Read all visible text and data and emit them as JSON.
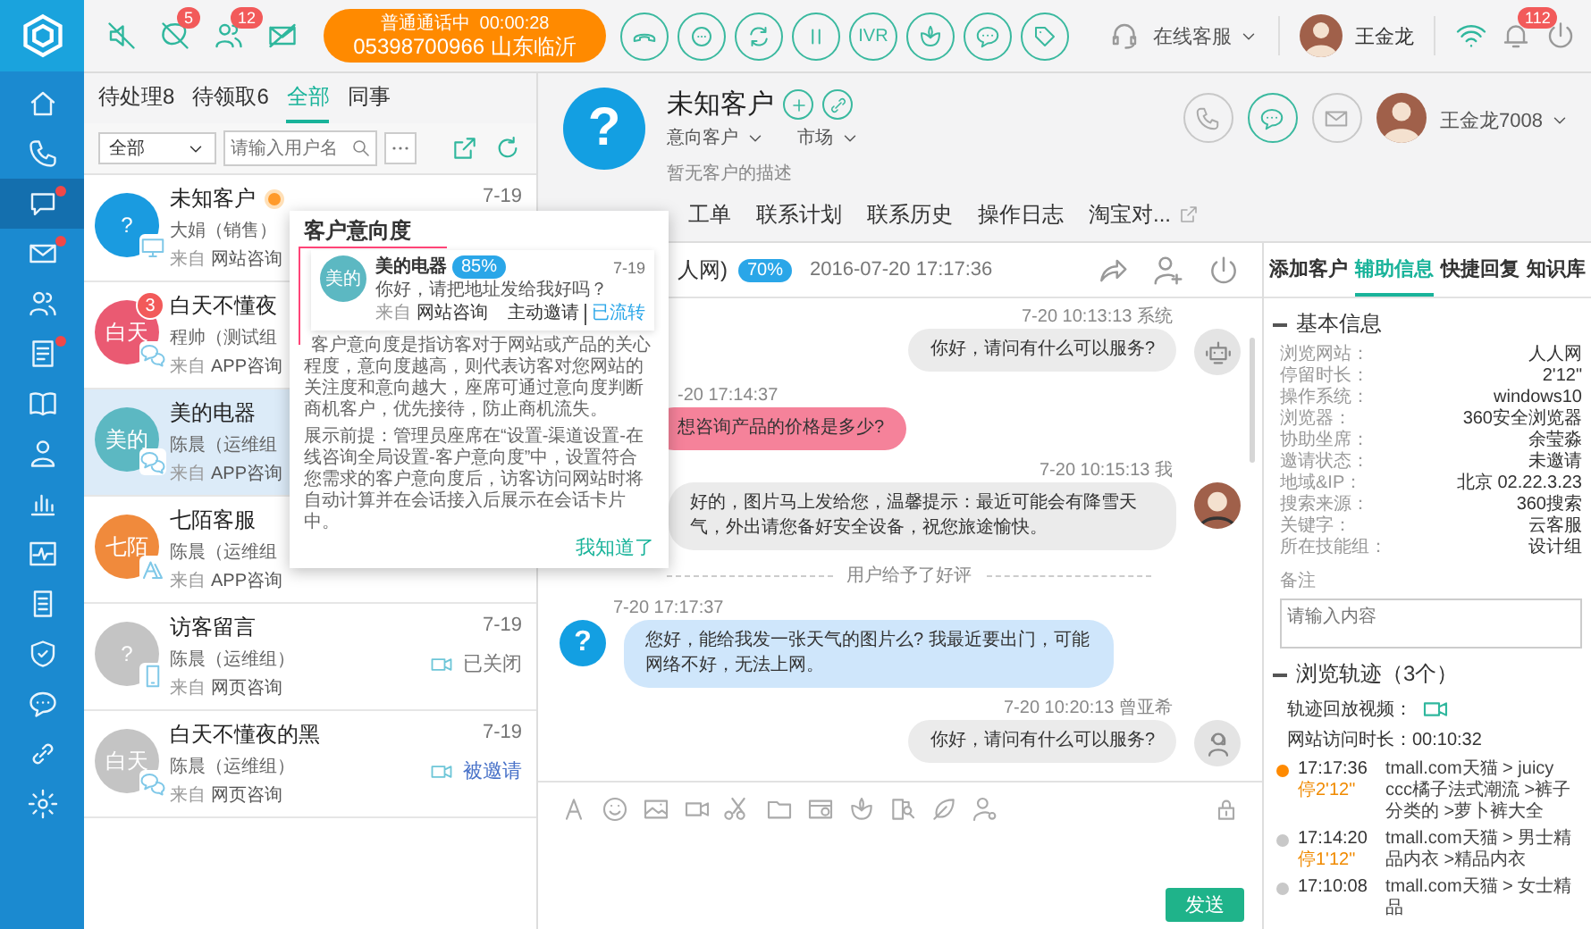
{
  "sidebar": {
    "items": [
      {
        "kind": "home",
        "selected": false,
        "alert": false
      },
      {
        "kind": "phone",
        "selected": false,
        "alert": false
      },
      {
        "kind": "chat",
        "selected": true,
        "alert": true
      },
      {
        "kind": "mail",
        "selected": false,
        "alert": true
      },
      {
        "kind": "people",
        "selected": false,
        "alert": false
      },
      {
        "kind": "list",
        "selected": false,
        "alert": true
      },
      {
        "kind": "book",
        "selected": false,
        "alert": false
      },
      {
        "kind": "person",
        "selected": false,
        "alert": false
      },
      {
        "kind": "chart",
        "selected": false,
        "alert": false
      },
      {
        "kind": "pulse",
        "selected": false,
        "alert": false
      },
      {
        "kind": "doc",
        "selected": false,
        "alert": false
      },
      {
        "kind": "shield",
        "selected": false,
        "alert": false
      },
      {
        "kind": "bubble",
        "selected": false,
        "alert": false
      },
      {
        "kind": "link",
        "selected": false,
        "alert": false
      },
      {
        "kind": "gear",
        "selected": false,
        "alert": false
      }
    ]
  },
  "top_bar": {
    "indicators": [
      {
        "kind": "mute"
      },
      {
        "kind": "phone-off",
        "badge": "5"
      },
      {
        "kind": "people",
        "badge": "12"
      },
      {
        "kind": "mail-off"
      }
    ],
    "call": {
      "status": "普通通话中",
      "timer": "00:00:28",
      "number": "05398700966 山东临沂"
    },
    "call_buttons": [
      {
        "kind": "hangup"
      },
      {
        "kind": "dial"
      },
      {
        "kind": "swap"
      },
      {
        "kind": "pause"
      },
      {
        "kind": "text",
        "label": "IVR"
      },
      {
        "kind": "flower"
      },
      {
        "kind": "bubble"
      },
      {
        "kind": "tag"
      }
    ],
    "agent_status": "在线客服",
    "agent_name": "王金龙",
    "notifications": "112"
  },
  "list_tabs": [
    {
      "label": "待处理8",
      "selected": false
    },
    {
      "label": "待领取6",
      "selected": false
    },
    {
      "label": "全部",
      "selected": true
    },
    {
      "label": "同事",
      "selected": false
    }
  ],
  "filter": {
    "value": "全部",
    "search_placeholder": "请输入用户名"
  },
  "conversations": [
    {
      "avatar": "?",
      "color": "#1a9be0",
      "kind": "web",
      "name": "未知客户",
      "flagged": true,
      "agent": "大娟（销售）",
      "from_label": "来自",
      "source": "网站咨询",
      "time": "7-19",
      "selected": false
    },
    {
      "avatar": "白天",
      "color": "#ea5a72",
      "kind": "wechat",
      "unread": "3",
      "name": "白天不懂夜",
      "flagged": false,
      "agent": "程帅（测试组",
      "from_label": "来自",
      "source": "APP咨询",
      "selected": false
    },
    {
      "avatar": "美的",
      "color": "#5cb8c2",
      "kind": "wechat",
      "name": "美的电器",
      "flagged": false,
      "agent": "陈晨（运维组",
      "from_label": "来自",
      "source": "APP咨询",
      "selected": true
    },
    {
      "avatar": "七陌",
      "color": "#f08a3c",
      "kind": "app",
      "name": "七陌客服",
      "flagged": false,
      "agent": "陈晨（运维组",
      "from_label": "来自",
      "source": "APP咨询",
      "selected": false
    },
    {
      "avatar": "?",
      "color": "#c4c4c4",
      "kind": "mobile",
      "name": "访客留言",
      "flagged": false,
      "agent": "陈晨（运维组）",
      "from_label": "来自",
      "source": "网页咨询",
      "time": "7-19",
      "status": {
        "kind": "closed",
        "label": "已关闭"
      },
      "selected": false
    },
    {
      "avatar": "白天",
      "color": "#c4c4c4",
      "kind": "wechat",
      "name": "白天不懂夜的黑",
      "flagged": false,
      "agent": "陈晨（运维组）",
      "from_label": "来自",
      "source": "网页咨询",
      "time": "7-19",
      "status": {
        "kind": "invited",
        "label": "被邀请"
      },
      "selected": false
    }
  ],
  "intent_popup": {
    "title": "客户意向度",
    "sample": {
      "avatar": "美的",
      "name": "美的电器",
      "score": "85%",
      "time": "7-19",
      "message": "你好，请把地址发给我好吗？",
      "action": "主动邀请",
      "state": "已流转",
      "from_label": "来自",
      "source": "网站咨询"
    },
    "paragraphs": [
      "客户意向度是指访客对于网站或产品的关心程度，意向度越高，则代表访客对您网站的关注度和意向越大，座席可通过意向度判断商机客户，优先接待，防止商机流失。",
      "展示前提：管理员座席在“设置-渠道设置-在线咨询全局设置-客户意向度”中，设置符合您需求的客户意向度后，访客访问网站时将自动计算并在会话接入后展示在会话卡片中。"
    ],
    "button": "我知道了"
  },
  "customer": {
    "avatar": "?",
    "name": "未知客户",
    "fields": [
      "意向客户",
      "市场"
    ],
    "description": "暂无客户的描述",
    "agent": "王金龙7008",
    "tabs": [
      "工单",
      "联系计划",
      "联系历史",
      "操作日志",
      "淘宝对..."
    ]
  },
  "chat": {
    "source": "人网)",
    "score": "70%",
    "started": "2016-07-20 17:17:36",
    "messages": [
      {
        "kind": "agent",
        "avatar": {
          "kind": "robot"
        },
        "meta": "7-20  10:13:13  系统",
        "text": "你好，请问有什么可以服务?",
        "color": "#ebebeb"
      },
      {
        "kind": "customer",
        "meta": "-20  17:14:37",
        "text": "想咨询产品的价格是多少?",
        "color": "#f5829a"
      },
      {
        "kind": "agent",
        "avatar": {
          "kind": "photo"
        },
        "meta": "7-20  10:15:13  我",
        "text": "好的，图片马上发给您，温馨提示：最近可能会有降雪天气，外出请您备好安全设备，祝您旅途愉快。",
        "color": "#ebebeb"
      },
      {
        "kind": "notice",
        "text": "用户给予了好评"
      },
      {
        "kind": "customer",
        "avatar": {
          "kind": "question",
          "text": "?"
        },
        "meta": "7-20  17:17:37",
        "text": "您好，能给我发一张天气的图片么? 我最近要出门，可能网络不好，无法上网。",
        "color": "#cfe6fb"
      },
      {
        "kind": "agent",
        "avatar": {
          "kind": "headset"
        },
        "meta": "7-20  10:20:13  曾亚希",
        "text": "你好，请问有什么可以服务?",
        "color": "#ebebeb"
      }
    ],
    "send": "发送"
  },
  "info_tabs": [
    {
      "label": "添加客户",
      "selected": false
    },
    {
      "label": "辅助信息",
      "selected": true
    },
    {
      "label": "快捷回复",
      "selected": false
    },
    {
      "label": "知识库",
      "selected": false
    }
  ],
  "basic_info": {
    "title": "基本信息",
    "rows": [
      {
        "label": "浏览网站：",
        "value": "人人网"
      },
      {
        "label": "停留时长：",
        "value": "2'12\""
      },
      {
        "label": "操作系统：",
        "value": "windows10"
      },
      {
        "label": "浏览器：",
        "value": "360安全浏览器"
      },
      {
        "label": "协助坐席：",
        "value": "余莹淼"
      },
      {
        "label": "邀请状态：",
        "value": "未邀请"
      },
      {
        "label": "地域&IP：",
        "value": "北京  02.22.3.23"
      },
      {
        "label": "搜索来源：",
        "value": "360搜索"
      },
      {
        "label": "关键字：",
        "value": "云客服"
      },
      {
        "label": "所在技能组：",
        "value": "设计组"
      }
    ],
    "note_label": "备注",
    "note_placeholder": "请输入内容"
  },
  "trail": {
    "title": "浏览轨迹（3个）",
    "video_label": "轨迹回放视频：",
    "duration": "网站访问时长：00:10:32",
    "entries": [
      {
        "time": "17:17:36",
        "stay": "停2'12\"",
        "path": "tmall.com天猫 > juicy ccc橘子法式潮流 >裤子分类的 >萝卜裤大全",
        "current": true
      },
      {
        "time": "17:14:20",
        "stay": "停1'12\"",
        "path": "tmall.com天猫 > 男士精品内衣 >精品内衣",
        "current": false
      },
      {
        "time": "17:10:08",
        "path": "tmall.com天猫 > 女士精品",
        "current": false
      }
    ]
  }
}
